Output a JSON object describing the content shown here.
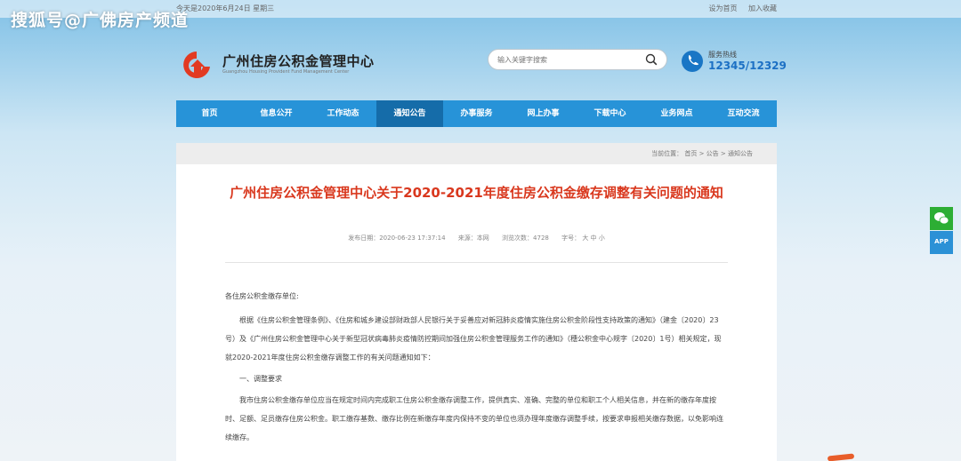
{
  "topbar": {
    "date": "今天是2020年6月24日 星期三",
    "set_home": "设为首页",
    "favorite": "加入收藏"
  },
  "watermark": "搜狐号@广佛房产频道",
  "logo": {
    "name_cn": "广州住房公积金管理中心",
    "name_en": "Guangzhou Housing Provident Fund Management Center"
  },
  "search": {
    "placeholder": "输入关键字搜索"
  },
  "hotline": {
    "label": "服务热线",
    "number": "12345/12329"
  },
  "nav": {
    "items": [
      "首页",
      "信息公开",
      "工作动态",
      "通知公告",
      "办事服务",
      "网上办事",
      "下载中心",
      "业务网点",
      "互动交流"
    ],
    "active_index": 3
  },
  "breadcrumb": "当前位置： 首页 > 公告 > 通知公告",
  "article": {
    "title": "广州住房公积金管理中心关于2020-2021年度住房公积金缴存调整有关问题的通知",
    "publish_date": "发布日期：2020-06-23 17:37:14",
    "source": "来源：本网",
    "views": "浏览次数：4728",
    "font_size": "字号： 大  中  小",
    "salutation": "各住房公积金缴存单位:",
    "para1": "根据《住房公积金管理条例》、《住房和城乡建设部财政部人民银行关于妥善应对新冠肺炎疫情实施住房公积金阶段性支持政策的通知》（建金〔2020〕23号）及《广州住房公积金管理中心关于新型冠状病毒肺炎疫情防控期间加强住房公积金管理服务工作的通知》（穗公积金中心规字〔2020〕1号）相关规定，现就2020-2021年度住房公积金缴存调整工作的有关问题通知如下：",
    "section1": "一、调整要求",
    "para2": "我市住房公积金缴存单位应当在规定时间内完成职工住房公积金缴存调整工作，提供真实、准确、完整的单位和职工个人相关信息，并在新的缴存年度按时、足额、足员缴存住房公积金。职工缴存基数、缴存比例在新缴存年度内保持不变的单位也须办理年度缴存调整手续，按要求申报相关缴存数据，以免影响连续缴存。"
  },
  "side": {
    "wechat_icon": "wechat-icon",
    "app_label": "APP"
  },
  "colors": {
    "nav": "#2793d8",
    "nav_active": "#156ca9",
    "title": "#d9381e",
    "hotline": "#1c70c4"
  }
}
